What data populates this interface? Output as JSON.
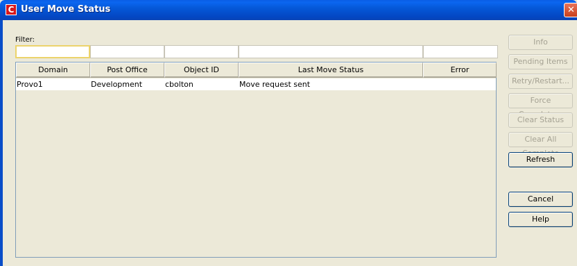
{
  "window": {
    "title": "User Move Status",
    "app_icon_glyph": "C",
    "close_glyph": "✕"
  },
  "filter": {
    "label": "Filter:",
    "values": [
      "",
      "",
      "",
      "",
      ""
    ]
  },
  "table": {
    "columns": [
      "Domain",
      "Post Office",
      "Object ID",
      "Last Move Status",
      "Error"
    ],
    "rows": [
      [
        "Provo1",
        "Development",
        "cbolton",
        "Move request sent",
        ""
      ]
    ]
  },
  "buttons": {
    "info": "Info",
    "pending_items": "Pending Items",
    "retry_restart": "Retry/Restart...",
    "force_complete": "Force Complete...",
    "clear_status": "Clear Status",
    "clear_all_complete": "Clear All Complete",
    "refresh": "Refresh",
    "cancel": "Cancel",
    "help": "Help"
  },
  "colors": {
    "titlebar": "#0558d8",
    "dialog_bg": "#ece9d8",
    "icon_red": "#d8171b",
    "disabled_text": "#a5a293"
  }
}
